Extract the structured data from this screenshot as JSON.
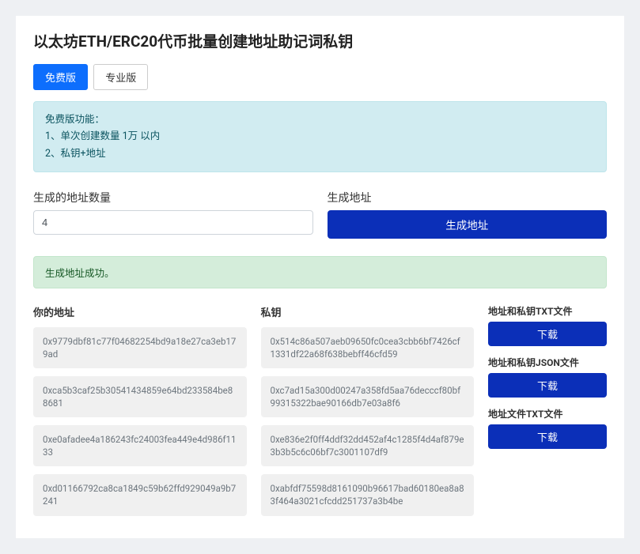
{
  "title": "以太坊ETH/ERC20代币批量创建地址助记词私钥",
  "tabs": {
    "free": "免费版",
    "pro": "专业版"
  },
  "info": {
    "heading": "免费版功能：",
    "line1": "1、单次创建数量 1万 以内",
    "line2": "2、私钥+地址"
  },
  "form": {
    "count_label": "生成的地址数量",
    "count_value": "4",
    "gen_label": "生成地址",
    "gen_button": "生成地址"
  },
  "status": "生成地址成功。",
  "columns": {
    "address": "你的地址",
    "private_key": "私钥"
  },
  "rows": [
    {
      "addr": "0x9779dbf81c77f04682254bd9a18e27ca3eb179ad",
      "key": "0x514c86a507aeb09650fc0cea3cbb6bf7426cf1331df22a68f638bebff46cfd59"
    },
    {
      "addr": "0xca5b3caf25b30541434859e64bd233584be88681",
      "key": "0xc7ad15a300d00247a358fd5aa76decccf80bf99315322bae90166db7e03a8f6"
    },
    {
      "addr": "0xe0afadee4a186243fc24003fea449e4d986f1133",
      "key": "0xe836e2f0ff4ddf32dd452af4c1285f4d4af879e3b3b5c6c06bf7c3001107df9"
    },
    {
      "addr": "0xd01166792ca8ca1849c59b62ffd929049a9b7241",
      "key": "0xabfdf75598d8161090b96617bad60180ea8a83f464a3021cfcdd251737a3b4be"
    }
  ],
  "downloads": {
    "txt_label": "地址和私钥TXT文件",
    "json_label": "地址和私钥JSON文件",
    "addr_txt_label": "地址文件TXT文件",
    "button": "下载"
  }
}
